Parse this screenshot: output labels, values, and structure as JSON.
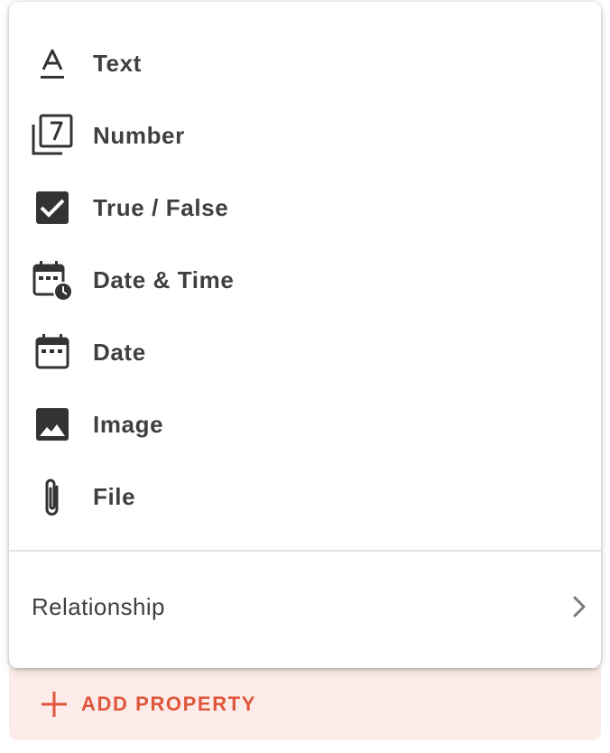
{
  "menu": {
    "items": [
      {
        "label": "Text",
        "icon": "text-icon"
      },
      {
        "label": "Number",
        "icon": "number-icon"
      },
      {
        "label": "True / False",
        "icon": "checkbox-icon"
      },
      {
        "label": "Date & Time",
        "icon": "calendar-clock-icon"
      },
      {
        "label": "Date",
        "icon": "calendar-icon"
      },
      {
        "label": "Image",
        "icon": "image-icon"
      },
      {
        "label": "File",
        "icon": "paperclip-icon"
      }
    ],
    "relationship": {
      "label": "Relationship",
      "icon": "chevron-right-icon"
    }
  },
  "add_property": {
    "label": "ADD PROPERTY",
    "icon": "plus-icon"
  },
  "colors": {
    "accent": "#e0563b",
    "accent_background": "#fcebe8",
    "text": "#3f3f3f",
    "icon": "#333333"
  }
}
